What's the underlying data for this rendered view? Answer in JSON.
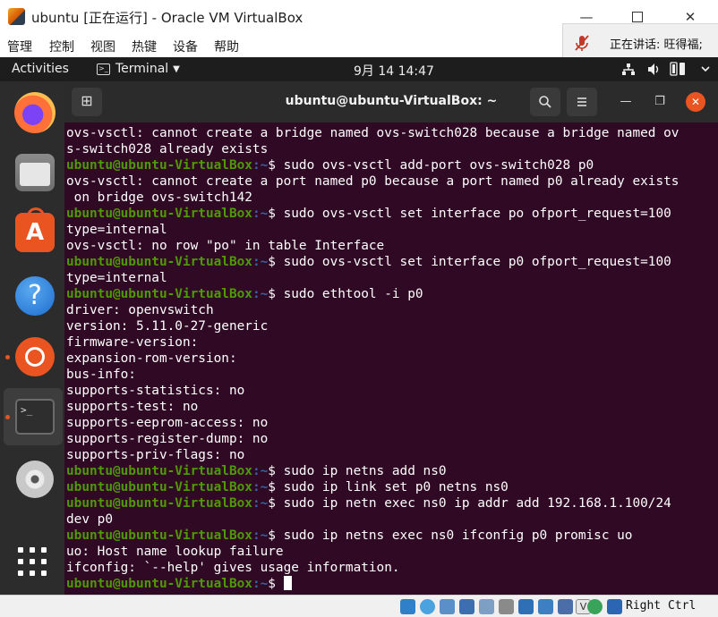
{
  "vbox": {
    "title": "ubuntu [正在运行] - Oracle VM VirtualBox",
    "menu": [
      "管理",
      "控制",
      "视图",
      "热键",
      "设备",
      "帮助"
    ],
    "speaking": "正在讲话: 旺得福;",
    "host_key": "Right Ctrl"
  },
  "gnome": {
    "activities": "Activities",
    "app_name": "Terminal",
    "clock": "9月 14  14:47"
  },
  "dock": {
    "items": [
      "firefox-icon",
      "files-icon",
      "software-store-icon",
      "help-icon",
      "ubuntu-icon",
      "terminal-icon",
      "disc-icon",
      "show-apps-icon"
    ]
  },
  "terminal": {
    "title": "ubuntu@ubuntu-VirtualBox: ~",
    "prompt_user": "ubuntu@ubuntu-VirtualBox",
    "prompt_path": ":~",
    "prompt_sign": "$ ",
    "lines": [
      {
        "text": "ovs-vsctl: cannot create a bridge named ovs-switch028 because a bridge named ov"
      },
      {
        "text": "s-switch028 already exists"
      },
      {
        "cmd": "sudo ovs-vsctl add-port ovs-switch028 p0"
      },
      {
        "text": "ovs-vsctl: cannot create a port named p0 because a port named p0 already exists"
      },
      {
        "text": " on bridge ovs-switch142"
      },
      {
        "cmd": "sudo ovs-vsctl set interface po ofport_request=100"
      },
      {
        "text": "type=internal"
      },
      {
        "text": "ovs-vsctl: no row \"po\" in table Interface"
      },
      {
        "cmd": "sudo ovs-vsctl set interface p0 ofport_request=100"
      },
      {
        "text": "type=internal"
      },
      {
        "cmd": "sudo ethtool -i p0"
      },
      {
        "text": "driver: openvswitch"
      },
      {
        "text": "version: 5.11.0-27-generic"
      },
      {
        "text": "firmware-version:"
      },
      {
        "text": "expansion-rom-version:"
      },
      {
        "text": "bus-info:"
      },
      {
        "text": "supports-statistics: no"
      },
      {
        "text": "supports-test: no"
      },
      {
        "text": "supports-eeprom-access: no"
      },
      {
        "text": "supports-register-dump: no"
      },
      {
        "text": "supports-priv-flags: no"
      },
      {
        "cmd": "sudo ip netns add ns0"
      },
      {
        "cmd": "sudo ip link set p0 netns ns0"
      },
      {
        "cmd": "sudo ip netn exec ns0 ip addr add 192.168.1.100/24"
      },
      {
        "text": "dev p0"
      },
      {
        "cmd": "sudo ip netns exec ns0 ifconfig p0 promisc uo"
      },
      {
        "text": "uo: Host name lookup failure"
      },
      {
        "text": "ifconfig: `--help' gives usage information."
      },
      {
        "cmd": "",
        "cursor": true
      }
    ]
  },
  "colors": {
    "terminal_bg": "#300a24",
    "prompt_user": "#4e9a06",
    "prompt_path": "#3465a4",
    "accent": "#e95420"
  }
}
